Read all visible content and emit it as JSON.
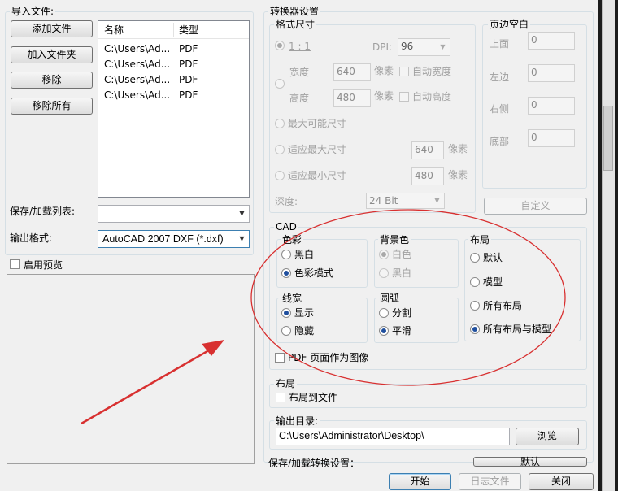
{
  "import": {
    "title": "导入文件:",
    "buttons": {
      "add_file": "添加文件",
      "add_folder": "加入文件夹",
      "remove": "移除",
      "remove_all": "移除所有"
    },
    "columns": [
      "名称",
      "类型"
    ],
    "files": [
      {
        "name": "C:\\Users\\Ad...",
        "type": "PDF"
      },
      {
        "name": "C:\\Users\\Ad...",
        "type": "PDF"
      },
      {
        "name": "C:\\Users\\Ad...",
        "type": "PDF"
      },
      {
        "name": "C:\\Users\\Ad...",
        "type": "PDF"
      }
    ],
    "save_list_label": "保存/加载列表:",
    "output_format_label": "输出格式:",
    "output_format_value": "AutoCAD 2007 DXF (*.dxf)",
    "enable_preview": "启用预览"
  },
  "converter": {
    "title": "转换器设置",
    "format": {
      "title": "格式尺寸",
      "ratio": "1 : 1",
      "dpi_label": "DPI:",
      "dpi_value": "96",
      "width_label": "宽度",
      "width_value": "640",
      "height_label": "高度",
      "height_value": "480",
      "unit": "像素",
      "auto_width": "自动宽度",
      "auto_height": "自动高度",
      "max_size": "最大可能尺寸",
      "fit_max": "适应最大尺寸",
      "fit_max_value": "640",
      "fit_min": "适应最小尺寸",
      "fit_min_value": "480",
      "depth_label": "深度:",
      "depth_value": "24 Bit"
    },
    "margins": {
      "title": "页边空白",
      "top": "上面",
      "left": "左边",
      "right": "右侧",
      "bottom": "底部",
      "value": "0",
      "custom_button": "自定义"
    },
    "cad": {
      "title": "CAD",
      "color": {
        "title": "色彩",
        "opt1": "黑白",
        "opt2": "色彩模式"
      },
      "background": {
        "title": "背景色",
        "opt1": "白色",
        "opt2": "黑白"
      },
      "layout": {
        "title": "布局",
        "opt1": "默认",
        "opt2": "模型",
        "opt3": "所有布局",
        "opt4": "所有布局与模型"
      },
      "lineweight": {
        "title": "线宽",
        "opt1": "显示",
        "opt2": "隐藏"
      },
      "arc": {
        "title": "圆弧",
        "opt1": "分割",
        "opt2": "平滑"
      },
      "pdf_as_image": "PDF 页面作为图像"
    },
    "layout_section": {
      "title": "布局",
      "layout_to_file": "布局到文件"
    },
    "output_dir": {
      "label": "输出目录:",
      "value": "C:\\Users\\Administrator\\Desktop\\",
      "browse": "浏览"
    },
    "save_settings": {
      "label": "保存/加载转换设置：",
      "default_button": "默认"
    }
  },
  "bottom": {
    "start": "开始",
    "log": "日志文件",
    "close": "关闭"
  },
  "colors": {
    "annotation_red": "#d83030"
  }
}
